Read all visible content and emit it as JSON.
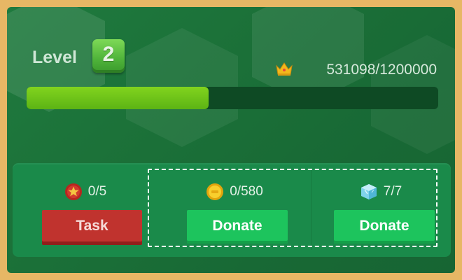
{
  "level": {
    "label": "Level",
    "value": "2"
  },
  "xp": {
    "text": "531098/1200000",
    "current": 531098,
    "max": 1200000,
    "icon": "crown-icon"
  },
  "tasks": {
    "count_text": "0/5",
    "button_label": "Task",
    "icon": "star-medal-icon"
  },
  "coin_donation": {
    "count_text": "0/580",
    "button_label": "Donate",
    "icon": "gold-coin-icon"
  },
  "gem_donation": {
    "count_text": "7/7",
    "button_label": "Donate",
    "icon": "ice-cube-icon"
  },
  "colors": {
    "background_border": "#e7b765",
    "panel_green": "#1a8a4a",
    "progress_fill": "#6cc41a",
    "task_button": "#c0332e",
    "donate_button": "#1dc45d"
  }
}
